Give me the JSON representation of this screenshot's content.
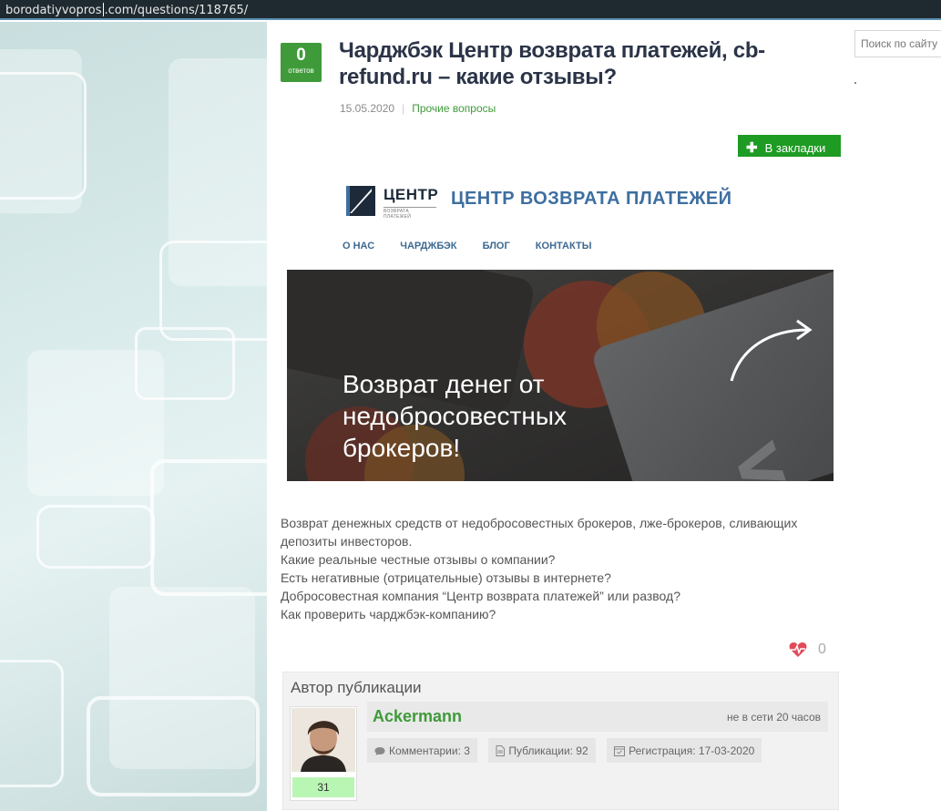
{
  "browser": {
    "url_before_caret": "borodatiyvopros",
    "url_after_caret": ".com/questions/118765/"
  },
  "sidebar": {
    "search_placeholder": "Поиск по сайту"
  },
  "question": {
    "answers_count": "0",
    "answers_label": "ответов",
    "title": "Чарджбэк Центр возврата платежей, cb-refund.ru – какие отзывы?",
    "date": "15.05.2020",
    "category": "Прочие вопросы",
    "bookmark_label": "В закладки"
  },
  "embedded_site": {
    "logo_word": "ЦЕНТР",
    "logo_sub": "ВОЗВРАТА ПЛАТЕЖЕЙ",
    "site_name": "ЦЕНТР ВОЗВРАТА ПЛАТЕЖЕЙ",
    "nav": [
      "О НАС",
      "ЧАРДЖБЭК",
      "БЛОГ",
      "КОНТАКТЫ"
    ],
    "banner_headline": "Возврат денег от недобросовестных брокеров!"
  },
  "body": {
    "lines": [
      "Возврат денежных средств от недобросовестных брокеров, лже-брокеров, сливающих депозиты инвесторов.",
      "Какие реальные честные отзывы о компании?",
      "Есть негативные (отрицательные) отзывы в интернете?",
      "Добросовестная компания “Центр возврата платежей” или развод?",
      "Как проверить чарджбэк-компанию?"
    ]
  },
  "likes": {
    "count": "0"
  },
  "author": {
    "header": "Автор публикации",
    "name": "Ackermann",
    "status": "не в сети 20 часов",
    "rating": "31",
    "comments": "Комментарии: 3",
    "publications": "Публикации: 92",
    "registration": "Регистрация: 17-03-2020"
  },
  "colors": {
    "accent_green": "#3f9a3a",
    "bookmark_green": "#1e9b23",
    "title_color": "#2b3447",
    "site_blue": "#3e6fa0"
  }
}
